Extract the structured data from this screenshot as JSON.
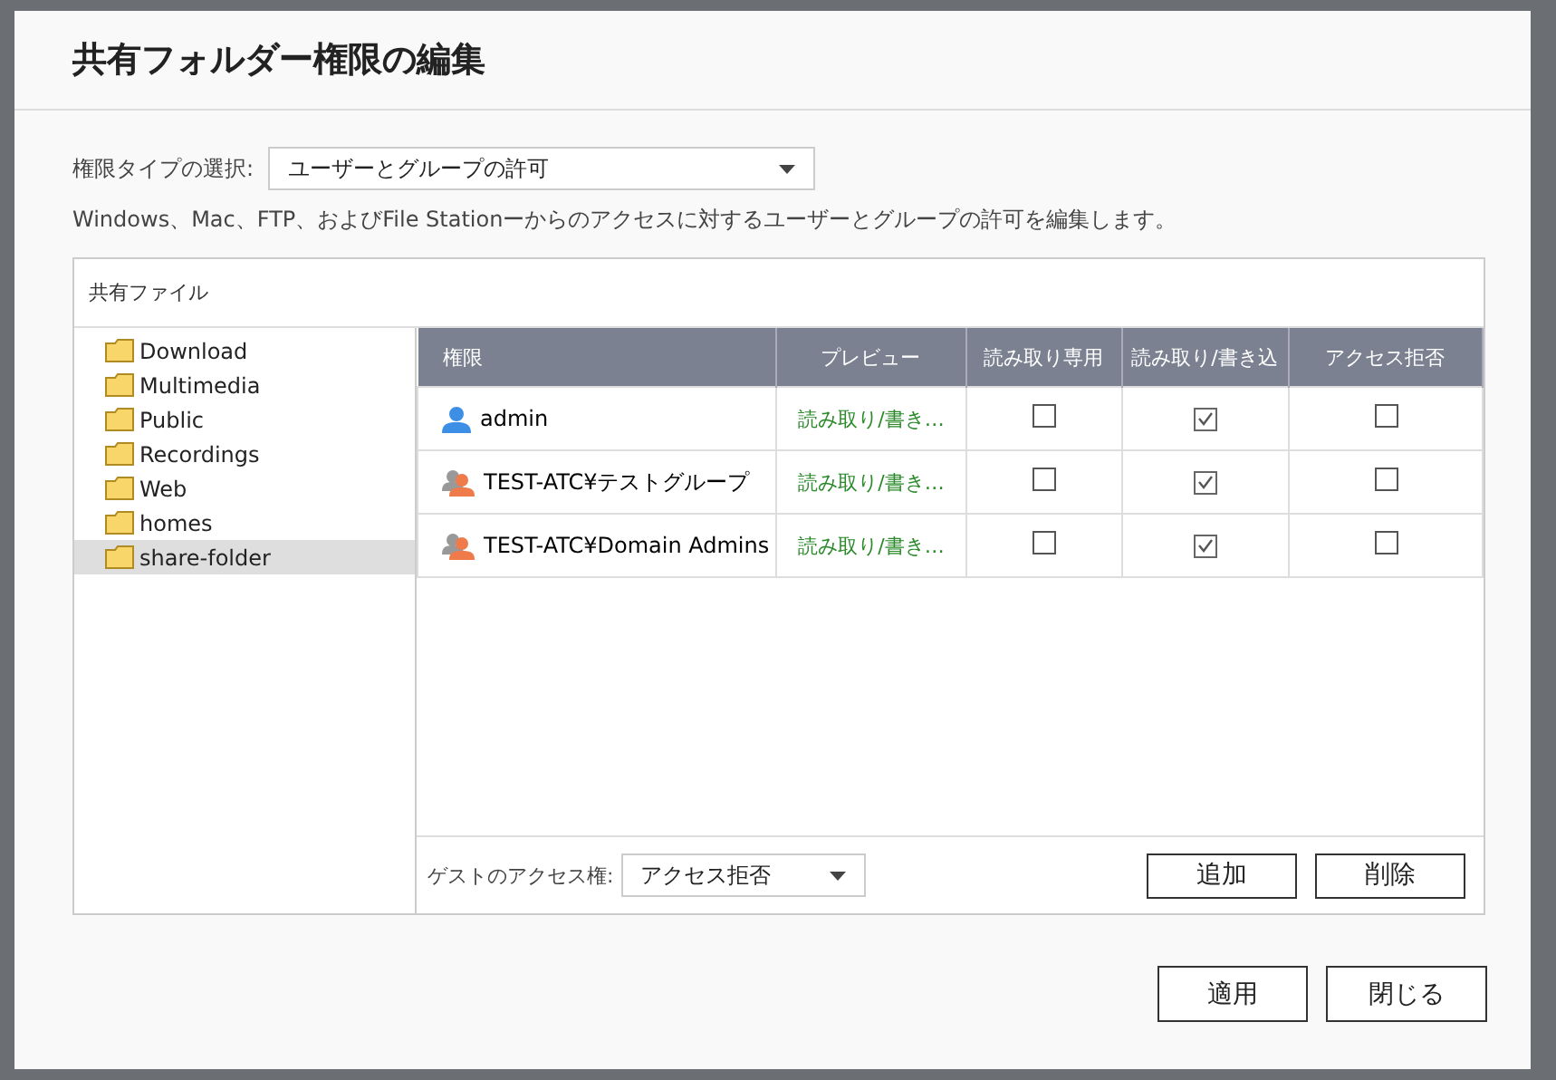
{
  "dialog": {
    "title": "共有フォルダー権限の編集"
  },
  "permission_type": {
    "label": "権限タイプの選択:",
    "value": "ユーザーとグループの許可"
  },
  "description": "Windows、Mac、FTP、およびFile Stationーからのアクセスに対するユーザーとグループの許可を編集します。",
  "panel": {
    "title": "共有ファイル"
  },
  "folders": [
    {
      "name": "Download",
      "selected": false
    },
    {
      "name": "Multimedia",
      "selected": false
    },
    {
      "name": "Public",
      "selected": false
    },
    {
      "name": "Recordings",
      "selected": false
    },
    {
      "name": "Web",
      "selected": false
    },
    {
      "name": "homes",
      "selected": false
    },
    {
      "name": "share-folder",
      "selected": true
    }
  ],
  "table": {
    "columns": [
      "権限",
      "プレビュー",
      "読み取り専用",
      "読み取り/書き込",
      "アクセス拒否"
    ],
    "rows": [
      {
        "kind": "user",
        "name": "admin",
        "preview": "読み取り/書き…",
        "read_only": false,
        "read_write": true,
        "deny": false
      },
      {
        "kind": "group",
        "name": "TEST-ATC¥テストグループ",
        "preview": "読み取り/書き…",
        "read_only": false,
        "read_write": true,
        "deny": false
      },
      {
        "kind": "group",
        "name": "TEST-ATC¥Domain Admins",
        "preview": "読み取り/書き…",
        "read_only": false,
        "read_write": true,
        "deny": false
      }
    ]
  },
  "guest_access": {
    "label": "ゲストのアクセス権:",
    "value": "アクセス拒否"
  },
  "table_buttons": [
    "追加",
    "削除"
  ],
  "dialog_buttons": [
    "適用",
    "閉じる"
  ]
}
